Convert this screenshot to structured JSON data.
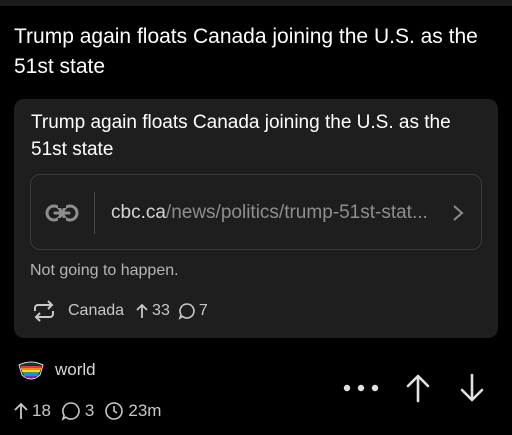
{
  "post": {
    "title": "Trump again floats Canada joining the U.S. as the 51st state"
  },
  "card": {
    "title": "Trump again floats Canada joining the U.S. as the 51st state",
    "link": {
      "domain": "cbc.ca",
      "path": "/news/politics/trump-51st-stat..."
    },
    "body": "Not going to happen.",
    "meta": {
      "crosspost_icon": "crosspost-icon",
      "community": "Canada",
      "upvotes": "33",
      "comments": "7"
    }
  },
  "footer": {
    "community": "world",
    "upvotes": "18",
    "comments": "3",
    "age": "23m"
  },
  "colors": {
    "background": "#000000",
    "card": "#1e1e1e",
    "text": "#ffffff",
    "muted": "#8e8e8e"
  }
}
